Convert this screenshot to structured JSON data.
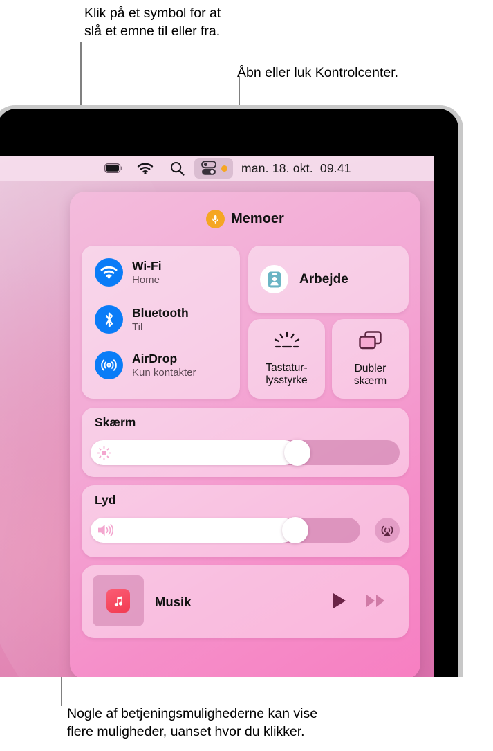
{
  "callouts": {
    "top_left": "Klik på et symbol for at\nslå et emne til eller fra.",
    "top_right": "Åbn eller luk Kontrolcenter.",
    "bottom": "Nogle af betjeningsmulighederne kan vise\nflere muligheder, uanset hvor du klikker."
  },
  "menubar": {
    "battery_icon": "battery-icon",
    "wifi_icon": "wifi-icon",
    "search_icon": "search-icon",
    "control_center_icon": "control-center-icon",
    "status_dot_color": "#f5a623",
    "clock": "man. 18. okt.  09.41"
  },
  "control_center": {
    "header": {
      "icon": "microphone-icon",
      "icon_color": "#f5a623",
      "label": "Memoer"
    },
    "connectivity": {
      "accent_color": "#0a7cf7",
      "items": [
        {
          "icon": "wifi-icon",
          "title": "Wi-Fi",
          "subtitle": "Home"
        },
        {
          "icon": "bluetooth-icon",
          "title": "Bluetooth",
          "subtitle": "Til"
        },
        {
          "icon": "airdrop-icon",
          "title": "AirDrop",
          "subtitle": "Kun kontakter"
        }
      ]
    },
    "focus": {
      "icon": "id-card-icon",
      "label": "Arbejde"
    },
    "small_tiles": [
      {
        "icon": "keyboard-brightness-icon",
        "label": "Tastatur-\nlysstyrke"
      },
      {
        "icon": "screen-mirroring-icon",
        "label": "Dubler\nskærm"
      }
    ],
    "display": {
      "title": "Skærm",
      "icon": "brightness-icon",
      "value_percent": 67
    },
    "sound": {
      "title": "Lyd",
      "icon": "speaker-icon",
      "value_percent": 76,
      "airplay_icon": "airplay-audio-icon"
    },
    "music": {
      "app_icon": "apple-music-icon",
      "label": "Musik",
      "play_icon": "play-icon",
      "next_icon": "fast-forward-icon"
    }
  }
}
